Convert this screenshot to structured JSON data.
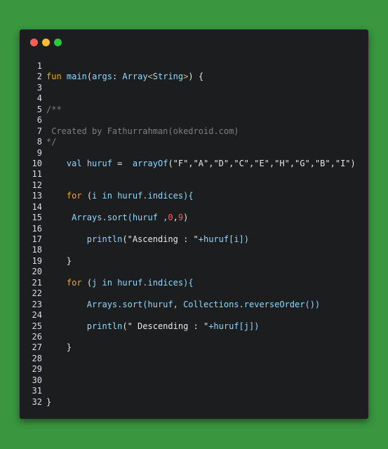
{
  "window": {
    "controls": [
      "close",
      "minimize",
      "maximize"
    ],
    "colors": {
      "close": "#ff5f56",
      "minimize": "#ffbd2e",
      "maximize": "#27c93f"
    }
  },
  "code": {
    "line_numbers": [
      "1",
      "2",
      "3",
      "4",
      "5",
      "6",
      "7",
      "8",
      "9",
      "10",
      "11",
      "12",
      "13",
      "14",
      "15",
      "16",
      "17",
      "18",
      "19",
      "20",
      "21",
      "22",
      "23",
      "24",
      "25",
      "26",
      "27",
      "28",
      "29",
      "30",
      "31",
      "32"
    ],
    "l2": {
      "kw": "fun",
      "name": "main",
      "open": "(",
      "param": "args",
      "colon": ": ",
      "type": "Array",
      "lt": "<",
      "targ": "String",
      "gt": ">",
      "close": ") {"
    },
    "l5": "/**",
    "l7": " Created by Fathurrahman(okedroid.com)",
    "l8": "*/",
    "l10": {
      "indent": "    ",
      "kw": "val",
      "sp": " ",
      "var": "huruf",
      "eq": " =  ",
      "fn": "arrayOf",
      "args": "(\"F\",\"A\",\"D\",\"C\",\"E\",\"H\",\"G\",\"B\",\"I\")"
    },
    "l13": {
      "indent": "    ",
      "kw": "for",
      "open": " (",
      "var": "i",
      "in": " in ",
      "rest": "huruf.indices){"
    },
    "l15": {
      "indent": "     ",
      "call": "Arrays.sort",
      "open": "(huruf ,",
      "n0": "0",
      "comma": ",",
      "n9": "9",
      "close": ")"
    },
    "l17": {
      "indent": "        ",
      "call": "println",
      "str": "(\"Ascending : \"",
      "rest": "+huruf[i])"
    },
    "l19": "    }",
    "l21": {
      "indent": "    ",
      "kw": "for",
      "open": " (",
      "var": "j",
      "in": " in ",
      "rest": "huruf.indices){"
    },
    "l23": {
      "indent": "        ",
      "call": "Arrays.sort",
      "rest": "(huruf, Collections.reverseOrder())"
    },
    "l25": {
      "indent": "        ",
      "call": "println",
      "str": "(\" Descending : \"",
      "rest": "+huruf[j])"
    },
    "l27": "    }",
    "l32": "}"
  }
}
